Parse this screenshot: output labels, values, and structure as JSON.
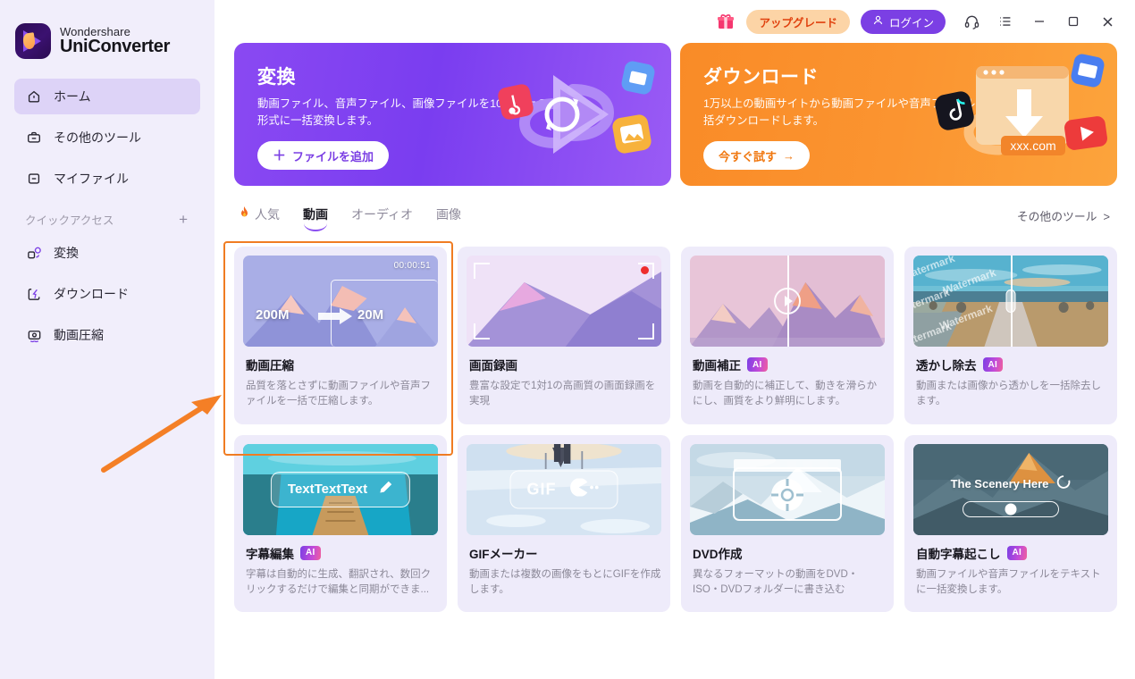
{
  "app": {
    "brand_top": "Wondershare",
    "brand_main": "UniConverter"
  },
  "titlebar": {
    "gift_icon": "gift-icon",
    "upgrade_label": "アップグレード",
    "login_label": "ログイン",
    "support_icon": "headset-icon",
    "menu_icon": "list-menu-icon",
    "minimize_icon": "minimize-icon",
    "maximize_icon": "maximize-icon",
    "close_icon": "close-icon"
  },
  "sidebar": {
    "items": [
      {
        "label": "ホーム",
        "icon": "home-icon",
        "active": true
      },
      {
        "label": "その他のツール",
        "icon": "toolbox-icon",
        "active": false
      },
      {
        "label": "マイファイル",
        "icon": "file-icon",
        "active": false
      }
    ],
    "quick_access": {
      "label": "クイックアクセス",
      "add_icon": "plus-icon",
      "items": [
        {
          "label": "変換",
          "icon": "convert-icon"
        },
        {
          "label": "ダウンロード",
          "icon": "download-icon"
        },
        {
          "label": "動画圧縮",
          "icon": "compress-icon"
        }
      ]
    }
  },
  "banners": [
    {
      "id": "convert",
      "title": "変換",
      "desc": "動画ファイル、音声ファイル、画像ファイルを1000以上の形式に一括変換します。",
      "button": "ファイルを追加",
      "button_icon": "plus-icon",
      "color": "#7b3fe4"
    },
    {
      "id": "download",
      "title": "ダウンロード",
      "desc": "1万以上の動画サイトから動画ファイルや音声ファイルを一括ダウンロードします。",
      "button": "今すぐ試す",
      "button_icon": "arrow-right-icon",
      "color": "#f98b27",
      "art_label": "xxx.com"
    }
  ],
  "tabs": {
    "items": [
      {
        "label": "人気",
        "icon": "fire-icon",
        "active": false
      },
      {
        "label": "動画",
        "icon": "",
        "active": true
      },
      {
        "label": "オーディオ",
        "icon": "",
        "active": false
      },
      {
        "label": "画像",
        "icon": "",
        "active": false
      }
    ],
    "more_tools": "その他のツール",
    "more_tools_icon": "chevron-right-icon"
  },
  "cards": [
    {
      "title": "動画圧縮",
      "desc": "品質を落とさずに動画ファイルや音声ファイルを一括で圧縮します。",
      "ai": false,
      "selected": true,
      "thumb": {
        "type": "compress",
        "timestamp": "00:00:51",
        "size_before": "200M",
        "size_after": "20M"
      }
    },
    {
      "title": "画面録画",
      "desc": "豊富な設定で1対1の高画質の画面録画を実現",
      "ai": false,
      "selected": false,
      "thumb": {
        "type": "record"
      }
    },
    {
      "title": "動画補正",
      "desc": "動画を自動的に補正して、動きを滑らかにし、画質をより鮮明にします。",
      "ai": true,
      "ai_label": "AI",
      "selected": false,
      "thumb": {
        "type": "enhance"
      }
    },
    {
      "title": "透かし除去",
      "desc": "動画または画像から透かしを一括除去します。",
      "ai": true,
      "ai_label": "AI",
      "selected": false,
      "thumb": {
        "type": "watermark",
        "watermark_text": "Watermark"
      }
    },
    {
      "title": "字幕編集",
      "desc": "字幕は自動的に生成、翻訳され、数回クリックするだけで編集と同期ができま...",
      "ai": true,
      "ai_label": "AI",
      "selected": false,
      "thumb": {
        "type": "subtitle",
        "overlay_text": "TextTextText",
        "overlay_icon": "pencil-icon"
      }
    },
    {
      "title": "GIFメーカー",
      "desc": "動画または複数の画像をもとにGIFを作成します。",
      "ai": false,
      "selected": false,
      "thumb": {
        "type": "gif",
        "overlay_text": "GIF"
      }
    },
    {
      "title": "DVD作成",
      "desc": "異なるフォーマットの動画をDVD・ISO・DVDフォルダーに書き込む",
      "ai": false,
      "selected": false,
      "thumb": {
        "type": "dvd"
      }
    },
    {
      "title": "自動字幕起こし",
      "desc": "動画ファイルや音声ファイルをテキストに一括変換します。",
      "ai": true,
      "ai_label": "AI",
      "selected": false,
      "thumb": {
        "type": "transcribe",
        "overlay_text": "The Scenery Here"
      }
    }
  ],
  "annotation": {
    "highlight_color": "#f07c22",
    "arrow_icon": "arrow-pointer-icon"
  }
}
